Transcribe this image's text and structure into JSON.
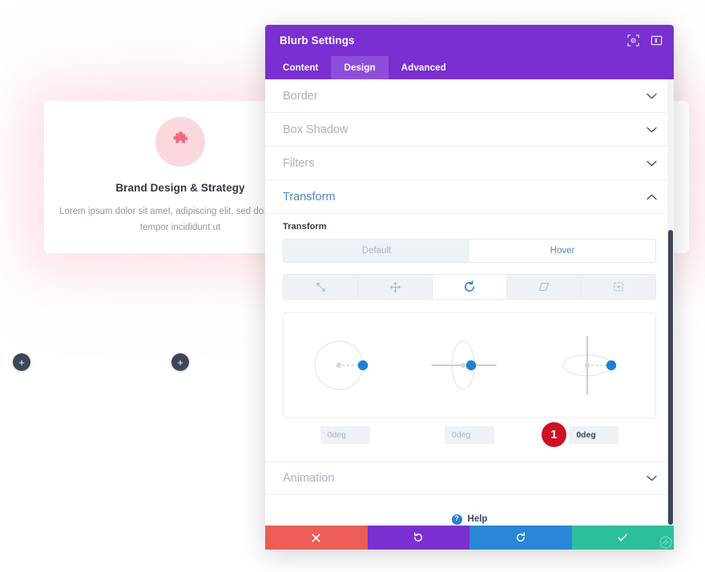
{
  "page": {
    "blurb": {
      "icon": "puzzle-piece-icon",
      "title": "Brand Design & Strategy",
      "body": "Lorem ipsum dolor sit amet, adipiscing elit, sed do eiusmod tempor incididunt ut"
    },
    "add_buttons": [
      {
        "label": "+",
        "name": "add-module-button-left"
      },
      {
        "label": "+",
        "name": "add-module-button-right"
      }
    ]
  },
  "modal": {
    "title": "Blurb Settings",
    "header_icons": [
      {
        "name": "focus-target-icon"
      },
      {
        "name": "panel-layout-icon"
      }
    ],
    "tabs": [
      {
        "label": "Content",
        "active": false
      },
      {
        "label": "Design",
        "active": true
      },
      {
        "label": "Advanced",
        "active": false
      }
    ],
    "sections": [
      {
        "label": "Border",
        "open": false
      },
      {
        "label": "Box Shadow",
        "open": false
      },
      {
        "label": "Filters",
        "open": false
      },
      {
        "label": "Transform",
        "open": true
      },
      {
        "label": "Animation",
        "open": false
      }
    ],
    "transform": {
      "field_label": "Transform",
      "states": [
        {
          "label": "Default",
          "active": false
        },
        {
          "label": "Hover",
          "active": true
        }
      ],
      "type_tabs": [
        {
          "icon": "scale-icon",
          "active": false
        },
        {
          "icon": "move-icon",
          "active": false
        },
        {
          "icon": "rotate-icon",
          "active": true
        },
        {
          "icon": "skew-icon",
          "active": false
        },
        {
          "icon": "origin-icon",
          "active": false
        }
      ],
      "dials": [
        {
          "axis": "z",
          "value": "0deg"
        },
        {
          "axis": "y",
          "value": "0deg"
        },
        {
          "axis": "x",
          "value": "0deg"
        }
      ],
      "badge": "1"
    },
    "help": {
      "icon": "question-mark-icon",
      "label": "Help"
    },
    "footer_buttons": [
      {
        "name": "cancel-button",
        "icon": "close-icon",
        "color": "#eb5d55"
      },
      {
        "name": "undo-button",
        "icon": "undo-icon",
        "color": "#7a2fd0"
      },
      {
        "name": "redo-button",
        "icon": "redo-icon",
        "color": "#2a86d6"
      },
      {
        "name": "save-button",
        "icon": "check-icon",
        "color": "#2bbf9b"
      }
    ],
    "resize_handle": "resize-grip-icon"
  },
  "colors": {
    "brand_purple": "#7a2fd0",
    "accent_blue": "#1e7fd4",
    "badge_red": "#cc1122",
    "blurb_pink": "#f0687f"
  }
}
